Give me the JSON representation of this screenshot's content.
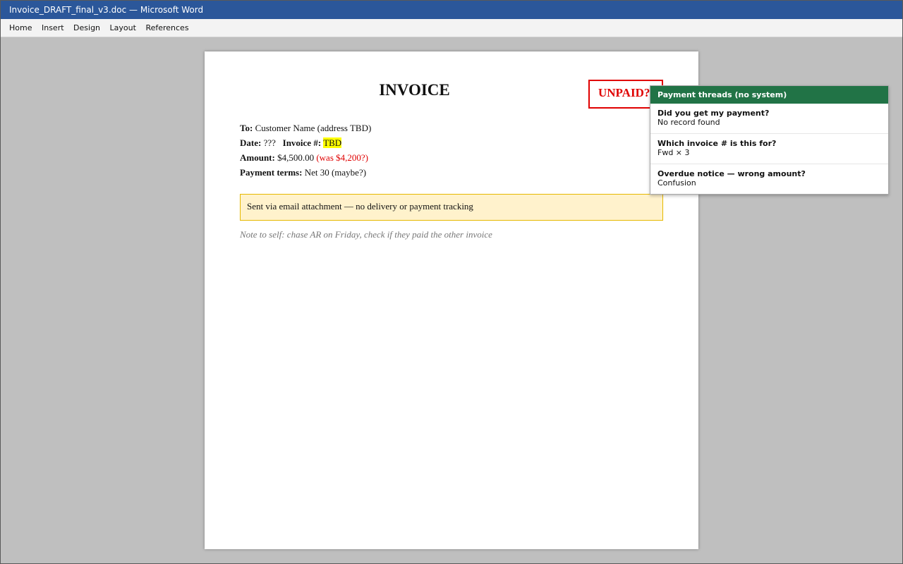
{
  "window": {
    "title": "Invoice_DRAFT_final_v3.doc — Microsoft Word"
  },
  "menu": {
    "items": [
      "Home",
      "Insert",
      "Design",
      "Layout",
      "References"
    ]
  },
  "document": {
    "title": "INVOICE",
    "stamp": "UNPAID?",
    "to_label": "To:",
    "to_value": "Customer Name (address TBD)",
    "date_label": "Date:",
    "date_value": "???",
    "invoice_label": "Invoice #:",
    "invoice_value": "TBD",
    "amount_label": "Amount:",
    "amount_value": "$4,500.00",
    "amount_old": "(was $4,200?)",
    "terms_label": "Payment terms:",
    "terms_value": "Net 30 (maybe?)",
    "notice": "Sent via email attachment — no delivery or payment tracking",
    "note": "Note to self: chase AR on Friday, check if they paid the other invoice"
  },
  "threads_panel": {
    "title": "Payment threads (no system)",
    "threads": [
      {
        "subject": "Did you get my payment?",
        "status": "No record found"
      },
      {
        "subject": "Which invoice # is this for?",
        "status": "Fwd × 3"
      },
      {
        "subject": "Overdue notice — wrong amount?",
        "status": "Confusion"
      }
    ]
  },
  "colors": {
    "titlebar": "#2b579a",
    "panel_header": "#217346",
    "stamp": "#e00000",
    "highlight": "#ffff00",
    "notice_bg": "#fff2cc"
  }
}
